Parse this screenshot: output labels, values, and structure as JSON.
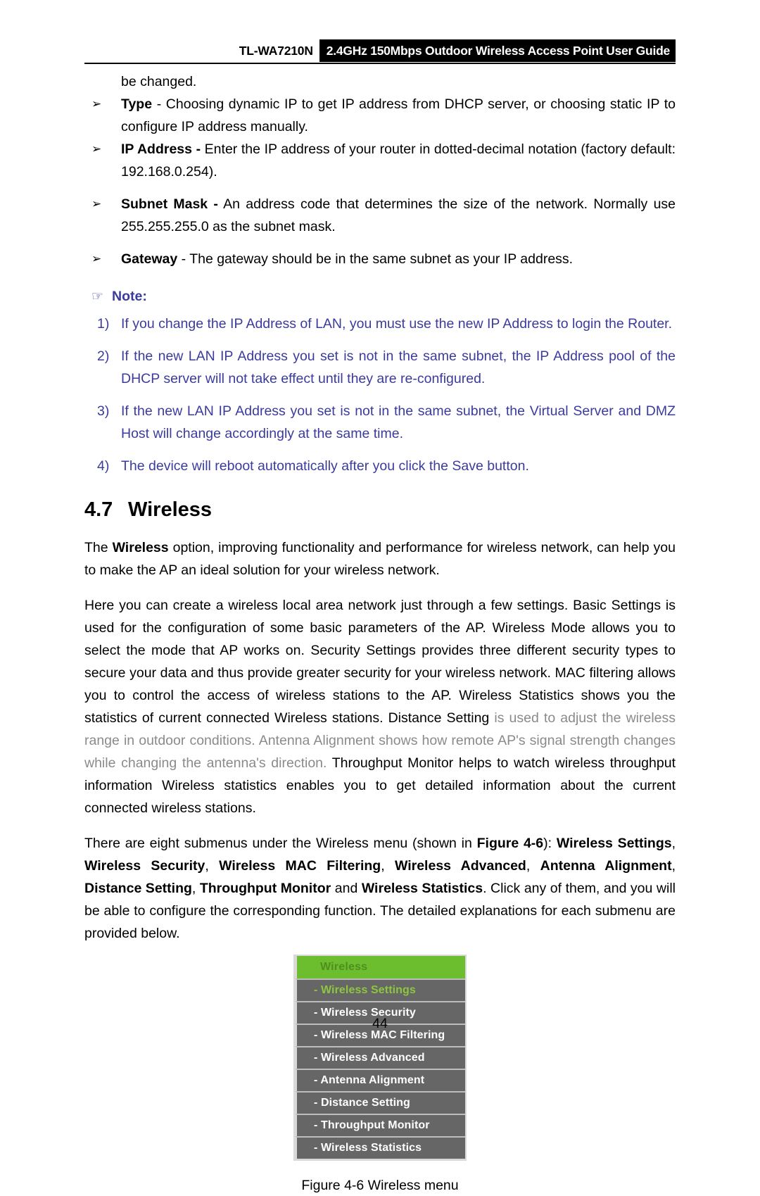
{
  "header": {
    "model": "TL-WA7210N",
    "title": "2.4GHz 150Mbps Outdoor Wireless Access Point User Guide"
  },
  "body": {
    "continued_line": "be changed.",
    "bullets": [
      {
        "marker": "➢",
        "term": "Type",
        "text": " - Choosing dynamic IP to get IP address from DHCP server, or choosing static IP to configure IP address manually."
      },
      {
        "marker": "➢",
        "term": "IP Address -",
        "text": " Enter the IP address of your router in dotted-decimal notation (factory default: 192.168.0.254)."
      },
      {
        "marker": "➢",
        "term": "Subnet Mask -",
        "text": " An address code that determines the size of the network. Normally use 255.255.255.0 as the subnet mask."
      },
      {
        "marker": "➢",
        "term": "Gateway",
        "text": " - The gateway should be in the same subnet as your IP address."
      }
    ],
    "note": {
      "icon": "☞",
      "label": "Note:",
      "color": "#3b3b9e",
      "items": [
        {
          "num": "1)",
          "text": "If you change the IP Address of LAN, you must use the new IP Address to login the Router."
        },
        {
          "num": "2)",
          "text": "If the new LAN IP Address you set is not in the same subnet, the IP Address pool of the DHCP server will not take effect until they are re-configured."
        },
        {
          "num": "3)",
          "text": "If the new LAN IP Address you set is not in the same subnet, the Virtual Server and DMZ Host will change accordingly at the same time."
        },
        {
          "num": "4)",
          "text": "The device will reboot automatically after you click the Save button."
        }
      ]
    },
    "section": {
      "number": "4.7",
      "title": "Wireless"
    },
    "para1": {
      "a": "The ",
      "b": "Wireless",
      "c": " option, improving functionality and performance for wireless network, can help you to make the AP an ideal solution for your wireless network."
    },
    "para2": {
      "black1": "Here you can create a wireless local area network just through a few settings. Basic Settings is used for the configuration of some basic parameters of the AP. Wireless Mode allows you to select the mode that AP works on. Security Settings provides three different security types to secure your data and thus provide greater security for your wireless network. MAC filtering allows you to control the access of wireless stations to the AP. Wireless Statistics shows you the statistics of current connected Wireless stations. Distance Setting ",
      "gray": "is used to adjust the wireless range in outdoor conditions. Antenna Alignment shows how remote AP's signal strength changes while changing the antenna's direction. ",
      "black2": "Throughput Monitor helps to watch wireless throughput information Wireless statistics enables you to get detailed information about the current connected wireless stations."
    },
    "para3": {
      "t1": "There are eight submenus under the Wireless menu (shown in ",
      "t2": "Figure 4-6",
      "t3": "): ",
      "t4": "Wireless Settings",
      "t5": ", ",
      "t6": "Wireless Security",
      "t7": ", ",
      "t8": "Wireless MAC Filtering",
      "t9": ", ",
      "t10": "Wireless Advanced",
      "t11": ", ",
      "t12": "Antenna Alignment",
      "t13": ", ",
      "t14": "Distance Setting",
      "t15": ", ",
      "t16": "Throughput Monitor",
      "t17": " and ",
      "t18": "Wireless Statistics",
      "t19": ". Click any of them, and you will be able to configure the corresponding function. The detailed explanations for each submenu are provided below."
    }
  },
  "figure": {
    "menu": {
      "header_label": "Wireless",
      "header_bg": "#6dbe2e",
      "header_text_color": "#4f8f1f",
      "item_bg": "#666666",
      "selected_text_color": "#8dc63f",
      "items": [
        {
          "label": "- Wireless Settings",
          "selected": true
        },
        {
          "label": "- Wireless Security",
          "selected": false
        },
        {
          "label": "- Wireless MAC Filtering",
          "selected": false
        },
        {
          "label": "- Wireless Advanced",
          "selected": false
        },
        {
          "label": "- Antenna Alignment",
          "selected": false
        },
        {
          "label": "- Distance Setting",
          "selected": false
        },
        {
          "label": "- Throughput Monitor",
          "selected": false
        },
        {
          "label": "- Wireless Statistics",
          "selected": false
        }
      ]
    },
    "caption": "Figure 4-6 Wireless menu"
  },
  "footer": {
    "page_number": "44"
  }
}
